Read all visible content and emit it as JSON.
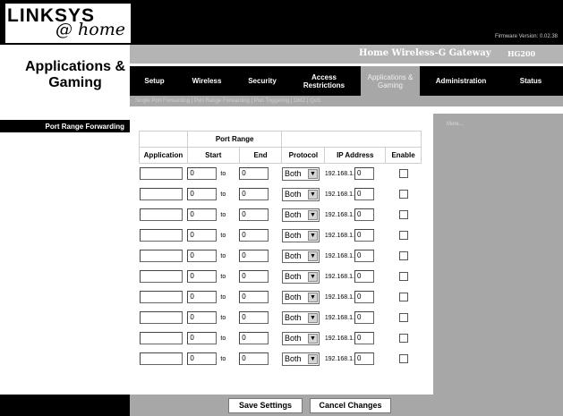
{
  "brand": {
    "logo_text": "LINKSYS",
    "logo_sub": "@ home",
    "firmware_label": "Firmware Version: 0.02.38"
  },
  "product": {
    "name": "Home Wireless-G Gateway",
    "model": "HG200"
  },
  "page_title": "Applications & Gaming",
  "tabs": [
    {
      "label": "Setup",
      "active": false
    },
    {
      "label": "Wireless",
      "active": false
    },
    {
      "label": "Security",
      "active": false
    },
    {
      "label": "Access Restrictions",
      "active": false
    },
    {
      "label": "Applications & Gaming",
      "active": true
    },
    {
      "label": "Administration",
      "active": false
    },
    {
      "label": "Status",
      "active": false
    }
  ],
  "subtabs": "Single Port Forwarding  |  Port Range Forwarding  |  Port Triggering  |  DMZ  |  QoS",
  "sidebar_section": "Port Range Forwarding",
  "more_link": "More...",
  "table": {
    "group_header": "Port Range",
    "columns": [
      "Application",
      "Start",
      "End",
      "Protocol",
      "IP Address",
      "Enable"
    ],
    "to_label": "to",
    "ip_prefix": "192.168.1.",
    "rows": [
      {
        "application": "",
        "start": "0",
        "end": "0",
        "protocol": "Both",
        "ip": "0",
        "enabled": false
      },
      {
        "application": "",
        "start": "0",
        "end": "0",
        "protocol": "Both",
        "ip": "0",
        "enabled": false
      },
      {
        "application": "",
        "start": "0",
        "end": "0",
        "protocol": "Both",
        "ip": "0",
        "enabled": false
      },
      {
        "application": "",
        "start": "0",
        "end": "0",
        "protocol": "Both",
        "ip": "0",
        "enabled": false
      },
      {
        "application": "",
        "start": "0",
        "end": "0",
        "protocol": "Both",
        "ip": "0",
        "enabled": false
      },
      {
        "application": "",
        "start": "0",
        "end": "0",
        "protocol": "Both",
        "ip": "0",
        "enabled": false
      },
      {
        "application": "",
        "start": "0",
        "end": "0",
        "protocol": "Both",
        "ip": "0",
        "enabled": false
      },
      {
        "application": "",
        "start": "0",
        "end": "0",
        "protocol": "Both",
        "ip": "0",
        "enabled": false
      },
      {
        "application": "",
        "start": "0",
        "end": "0",
        "protocol": "Both",
        "ip": "0",
        "enabled": false
      },
      {
        "application": "",
        "start": "0",
        "end": "0",
        "protocol": "Both",
        "ip": "0",
        "enabled": false
      }
    ]
  },
  "buttons": {
    "save": "Save Settings",
    "cancel": "Cancel Changes"
  },
  "colors": {
    "header_bg": "#000000",
    "panel_gray": "#a7a7a7",
    "active_tab": "#a7a7a7"
  }
}
